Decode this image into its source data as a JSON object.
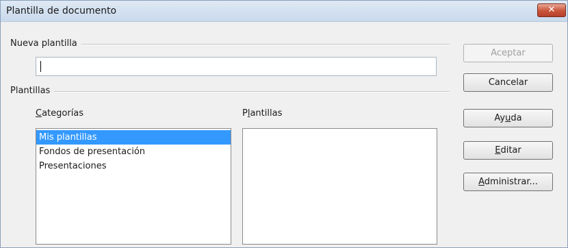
{
  "window": {
    "title": "Plantilla de documento",
    "close_label": "✕"
  },
  "new_template": {
    "label": "Nueva plantilla",
    "input_value": ""
  },
  "templates_section": {
    "label": "Plantillas",
    "categories": {
      "label_pre": "",
      "label_accel": "C",
      "label_post": "ategorías",
      "items": [
        "Mis plantillas",
        "Fondos de presentación",
        "Presentaciones"
      ],
      "selected_index": 0
    },
    "templates": {
      "label_pre": "P",
      "label_accel": "l",
      "label_post": "antillas",
      "items": []
    }
  },
  "buttons": {
    "accept": {
      "label": "Aceptar",
      "enabled": false
    },
    "cancel": {
      "label": "Cancelar"
    },
    "help": {
      "pre": "Ay",
      "accel": "u",
      "post": "da"
    },
    "edit": {
      "pre": "",
      "accel": "E",
      "post": "ditar"
    },
    "manage": {
      "pre": "",
      "accel": "A",
      "post": "dministrar..."
    }
  },
  "colors": {
    "selection": "#3399ff",
    "close_button": "#c9543a"
  }
}
